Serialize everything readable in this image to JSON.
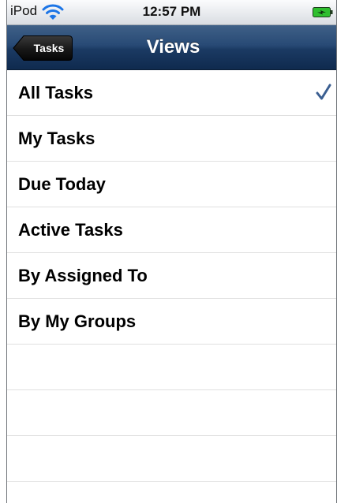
{
  "status_bar": {
    "carrier": "iPod",
    "time": "12:57 PM",
    "wifi_icon": "wifi-icon",
    "battery_icon": "battery-charging-icon"
  },
  "nav_bar": {
    "back_label": "Tasks",
    "title": "Views",
    "bar_color": "#1b3a63"
  },
  "views": [
    {
      "label": "All Tasks",
      "selected": true
    },
    {
      "label": "My Tasks",
      "selected": false
    },
    {
      "label": "Due Today",
      "selected": false
    },
    {
      "label": "Active Tasks",
      "selected": false
    },
    {
      "label": "By Assigned To",
      "selected": false
    },
    {
      "label": "By My Groups",
      "selected": false
    }
  ],
  "checkmark_color": "#3b5f91"
}
